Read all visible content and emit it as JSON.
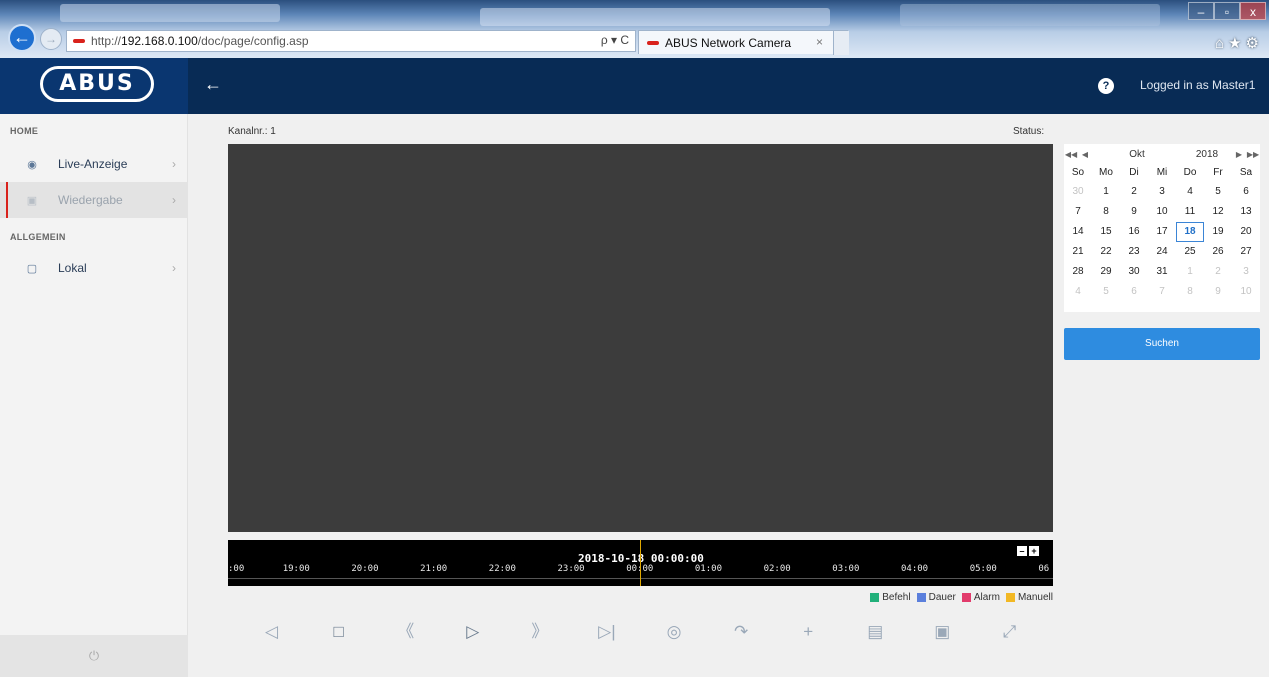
{
  "browser": {
    "address_prefix": "http://",
    "address_host": "192.168.0.100",
    "address_path": "/doc/page/config.asp",
    "addr_tools": "ρ ▾ C",
    "tab_title": "ABUS Network Camera",
    "tab_close": "×",
    "win_min": "–",
    "win_max": "▫",
    "win_close": "x",
    "back_icon": "←",
    "forward_icon": "→",
    "tool_icons": "⌂★⚙"
  },
  "header": {
    "logo": "ABUS",
    "back_icon": "←",
    "help_icon": "?",
    "logged_in": "Logged in as Master1"
  },
  "sidebar": {
    "section_home": "HOME",
    "section_general": "ALLGEMEIN",
    "items": [
      {
        "label": "Live-Anzeige",
        "icon": "eye-icon",
        "glyph": "◉"
      },
      {
        "label": "Wiedergabe",
        "icon": "playback-icon",
        "glyph": "▣"
      },
      {
        "label": "Lokal",
        "icon": "local-settings-icon",
        "glyph": "▢"
      }
    ],
    "chevron": "›",
    "power_icon": "⏻"
  },
  "main": {
    "channel": "Kanalnr.: 1",
    "status": "Status:"
  },
  "timeline": {
    "datetime": "2018-10-18 00:00:00",
    "zoom_out": "–",
    "zoom_in": "+",
    "ticks": [
      ":00",
      "19:00",
      "20:00",
      "21:00",
      "22:00",
      "23:00",
      "00:00",
      "01:00",
      "02:00",
      "03:00",
      "04:00",
      "05:00",
      "06"
    ]
  },
  "legend": [
    {
      "label": "Befehl",
      "color": "#22b07a"
    },
    {
      "label": "Dauer",
      "color": "#5b7fdc"
    },
    {
      "label": "Alarm",
      "color": "#e23c6c"
    },
    {
      "label": "Manuell",
      "color": "#f2b824"
    }
  ],
  "controls": [
    {
      "name": "stop-all-icon",
      "glyph": "◁"
    },
    {
      "name": "stop-icon",
      "glyph": "□"
    },
    {
      "name": "slow-icon",
      "glyph": "《"
    },
    {
      "name": "play-icon",
      "glyph": "▷"
    },
    {
      "name": "fast-icon",
      "glyph": "》"
    },
    {
      "name": "single-frame-icon",
      "glyph": "▷|"
    },
    {
      "name": "capture-icon",
      "glyph": "◎"
    },
    {
      "name": "clip-icon",
      "glyph": "↷"
    },
    {
      "name": "zoom-icon",
      "glyph": "+"
    },
    {
      "name": "download-picture-icon",
      "glyph": "▤"
    },
    {
      "name": "download-video-icon",
      "glyph": "▣"
    },
    {
      "name": "fullscreen-icon",
      "glyph": "⤢"
    }
  ],
  "calendar": {
    "month": "Okt",
    "year": "2018",
    "prev_year": "◀◀",
    "prev_month": "◀",
    "next_month": "▶",
    "next_year": "▶▶",
    "weekdays": [
      "So",
      "Mo",
      "Di",
      "Mi",
      "Do",
      "Fr",
      "Sa"
    ],
    "days": [
      {
        "d": "30",
        "o": true
      },
      {
        "d": "1"
      },
      {
        "d": "2"
      },
      {
        "d": "3"
      },
      {
        "d": "4"
      },
      {
        "d": "5"
      },
      {
        "d": "6"
      },
      {
        "d": "7"
      },
      {
        "d": "8"
      },
      {
        "d": "9"
      },
      {
        "d": "10"
      },
      {
        "d": "11"
      },
      {
        "d": "12"
      },
      {
        "d": "13"
      },
      {
        "d": "14"
      },
      {
        "d": "15"
      },
      {
        "d": "16"
      },
      {
        "d": "17"
      },
      {
        "d": "18",
        "sel": true
      },
      {
        "d": "19"
      },
      {
        "d": "20"
      },
      {
        "d": "21"
      },
      {
        "d": "22"
      },
      {
        "d": "23"
      },
      {
        "d": "24"
      },
      {
        "d": "25"
      },
      {
        "d": "26"
      },
      {
        "d": "27"
      },
      {
        "d": "28"
      },
      {
        "d": "29"
      },
      {
        "d": "30"
      },
      {
        "d": "31"
      },
      {
        "d": "1",
        "o": true
      },
      {
        "d": "2",
        "o": true
      },
      {
        "d": "3",
        "o": true
      },
      {
        "d": "4",
        "o": true
      },
      {
        "d": "5",
        "o": true
      },
      {
        "d": "6",
        "o": true
      },
      {
        "d": "7",
        "o": true
      },
      {
        "d": "8",
        "o": true
      },
      {
        "d": "9",
        "o": true
      },
      {
        "d": "10",
        "o": true
      }
    ]
  },
  "search_label": "Suchen"
}
